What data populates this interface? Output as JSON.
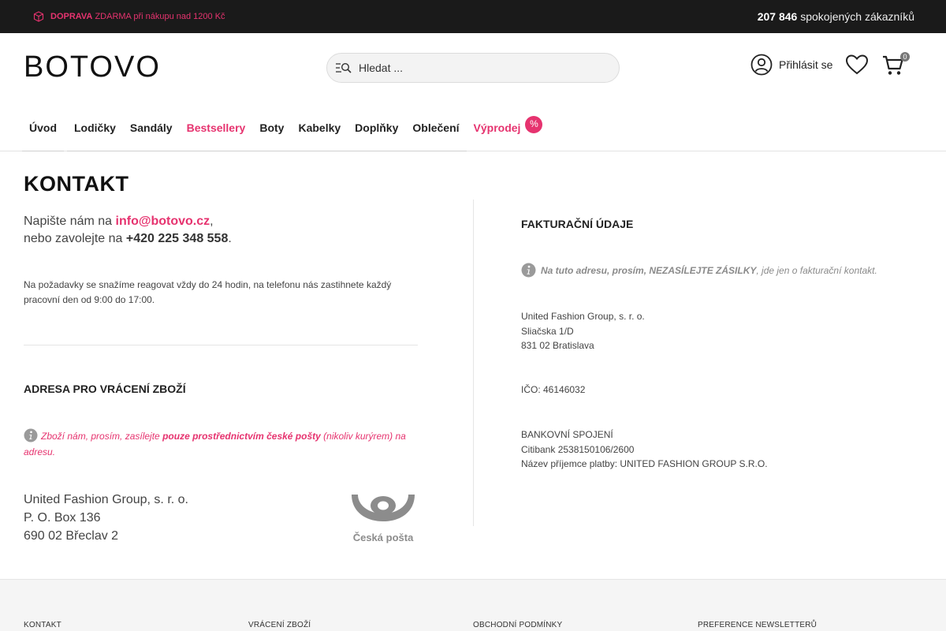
{
  "topbar": {
    "shipping_bold": "DOPRAVA",
    "shipping_text": "ZDARMA při nákupu nad 1200 Kč",
    "customers_count": "207 846",
    "customers_text": "spokojených zákazníků"
  },
  "header": {
    "logo": "BOTOVO",
    "search_placeholder": "Hledat ...",
    "login_label": "Přihlásit se",
    "cart_count": "0"
  },
  "nav": {
    "items": [
      "Úvod",
      "Lodičky",
      "Sandály",
      "Bestsellery",
      "Boty",
      "Kabelky",
      "Doplňky",
      "Oblečení",
      "Výprodej"
    ],
    "sale_badge": "%"
  },
  "page": {
    "title": "KONTAKT",
    "write_prefix": "Napište nám na",
    "email": "info@botovo.cz",
    "call_prefix": "nebo zavolejte na",
    "phone": "+420 225 348 558",
    "response_text": "Na požadavky se snažíme reagovat vždy do 24 hodin, na telefonu nás zastihnete každý pracovní den od 9:00 do 17:00."
  },
  "returns": {
    "heading": "ADRESA PRO VRÁCENÍ ZBOŽÍ",
    "note_prefix": "Zboží nám, prosím, zasílejte",
    "note_bold": "pouze prostřednictvím české pošty",
    "note_suffix": "(nikoliv kurýrem) na adresu.",
    "address": [
      "United Fashion Group, s. r. o.",
      "P. O. Box 136",
      "690 02 Břeclav 2"
    ],
    "logo_text": "Česká pošta"
  },
  "billing": {
    "heading": "FAKTURAČNÍ ÚDAJE",
    "note_bold": "Na tuto adresu, prosím, NEZASÍLEJTE ZÁSILKY",
    "note_rest": ", jde jen o fakturační kontakt.",
    "address": [
      "United Fashion Group, s. r. o.",
      "Sliačska 1/D",
      "831 02 Bratislava"
    ],
    "ico": "IČO: 46146032",
    "bank": [
      "BANKOVNÍ SPOJENÍ",
      "Citibank 2538150106/2600",
      "Název příjemce platby: UNITED FASHION GROUP S.R.O."
    ]
  },
  "footer": {
    "links": [
      "KONTAKT",
      "VRÁCENÍ ZBOŽÍ",
      "OBCHODNÍ PODMÍNKY",
      "PREFERENCE NEWSLETTERŮ"
    ]
  },
  "colors": {
    "accent": "#e6336f",
    "topbar": "#1a1a1a"
  }
}
